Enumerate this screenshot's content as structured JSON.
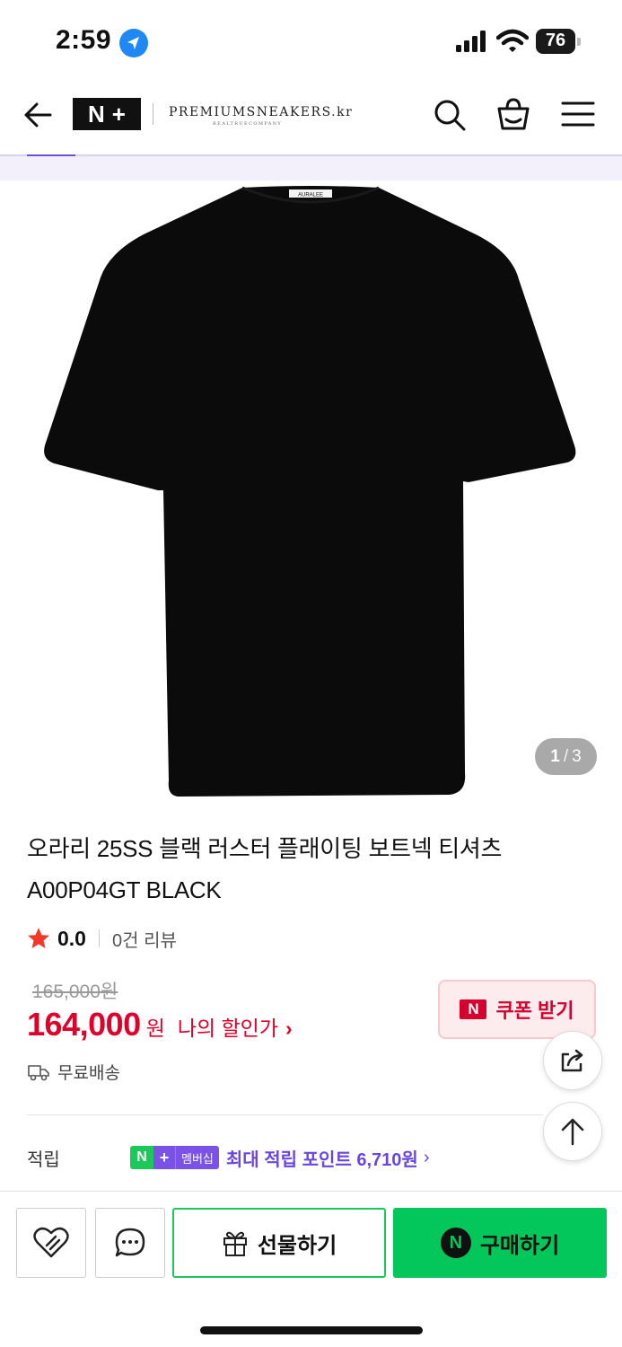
{
  "status_bar": {
    "time": "2:59",
    "battery": "76"
  },
  "header": {
    "logo_n": "N",
    "logo_plus": "+",
    "brand": "PREMIUMSNEAKERS.kr",
    "brand_sub": "REALTRUECOMPANY",
    "icons": [
      "back-arrow-icon",
      "search-icon",
      "cart-icon",
      "menu-icon"
    ]
  },
  "gallery": {
    "current": "1",
    "separator": "/",
    "total": "3",
    "image": "black t-shirt back view",
    "collar_tag": "AURALEE"
  },
  "product": {
    "title_line1": "오라리 25SS 블랙 러스터 플래이팅 보트넥 티셔츠",
    "title_line2": "A00P04GT BLACK",
    "rating": "0.0",
    "reviews": "0건 리뷰",
    "original_price": "165,000원",
    "price": "164,000",
    "currency": "원",
    "my_discount": "나의 할인가",
    "coupon_badge": "N",
    "coupon_label": "쿠폰 받기",
    "shipping": "무료배송"
  },
  "points": {
    "label": "적립",
    "badge_n": "N",
    "badge_plus": "+",
    "badge_membership": "멤버십",
    "description": "최대 적립 포인트 6,710원"
  },
  "bottom_bar": {
    "gift_label": "선물하기",
    "buy_badge": "N",
    "buy_label": "구매하기"
  },
  "colors": {
    "price_red": "#e0002a",
    "naver_green": "#03c75a",
    "membership_purple": "#7a52e8"
  }
}
